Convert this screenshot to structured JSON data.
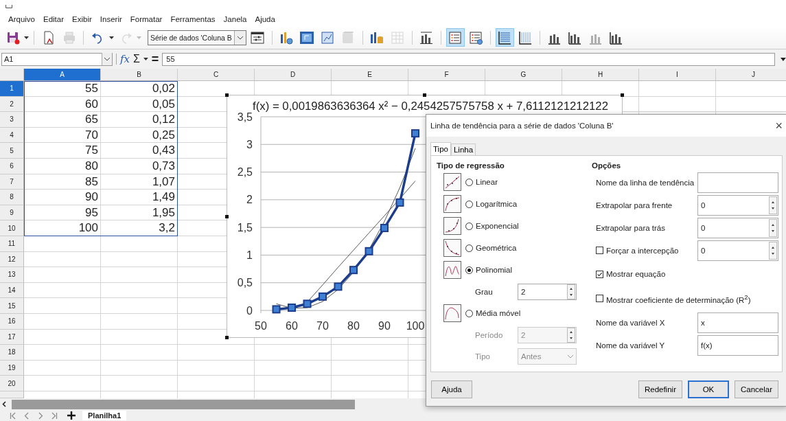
{
  "menu": [
    "Arquivo",
    "Editar",
    "Exibir",
    "Inserir",
    "Formatar",
    "Ferramentas",
    "Janela",
    "Ajuda"
  ],
  "toolbar": [
    {
      "kind": "save",
      "on": false,
      "disabled": false
    },
    {
      "kind": "caret",
      "disabled": false
    },
    {
      "kind": "sep"
    },
    {
      "kind": "export-pdf",
      "on": false,
      "disabled": false
    },
    {
      "kind": "print",
      "on": false,
      "disabled": true
    },
    {
      "kind": "sep"
    },
    {
      "kind": "undo",
      "on": false,
      "disabled": false
    },
    {
      "kind": "caret",
      "disabled": false
    },
    {
      "kind": "redo",
      "on": false,
      "disabled": true
    },
    {
      "kind": "caret",
      "disabled": true
    },
    {
      "kind": "select",
      "value": "Série de dados 'Coluna B"
    },
    {
      "kind": "format-selection",
      "on": false,
      "disabled": false
    },
    {
      "kind": "sep"
    },
    {
      "kind": "chart-type",
      "on": false,
      "disabled": false
    },
    {
      "kind": "chart-wall",
      "on": false,
      "disabled": false
    },
    {
      "kind": "chart-area",
      "on": false,
      "disabled": false
    },
    {
      "kind": "cube",
      "on": false,
      "disabled": true
    },
    {
      "kind": "sep"
    },
    {
      "kind": "data-ranges",
      "on": false,
      "disabled": false
    },
    {
      "kind": "data-table",
      "on": false,
      "disabled": true
    },
    {
      "kind": "sep"
    },
    {
      "kind": "titles",
      "on": false,
      "disabled": false
    },
    {
      "kind": "sep"
    },
    {
      "kind": "legend-toggle",
      "on": true,
      "disabled": false
    },
    {
      "kind": "legend",
      "on": false,
      "disabled": false
    },
    {
      "kind": "sep"
    },
    {
      "kind": "h-grid",
      "on": true,
      "disabled": false
    },
    {
      "kind": "v-grid",
      "on": false,
      "disabled": false
    },
    {
      "kind": "sep"
    },
    {
      "kind": "x-axis",
      "on": false,
      "disabled": false
    },
    {
      "kind": "y-axis",
      "on": false,
      "disabled": false
    },
    {
      "kind": "x-axis",
      "on": false,
      "disabled": true
    },
    {
      "kind": "y-axis",
      "on": false,
      "disabled": false
    }
  ],
  "formula_bar": {
    "name_box": "A1",
    "function_sign": "fx",
    "sum_sign": "Σ",
    "equals_sign": "=",
    "value": "55"
  },
  "sheet": {
    "columns": [
      {
        "label": "A",
        "selected": true
      },
      {
        "label": "B",
        "selected": false
      },
      {
        "label": "C",
        "selected": false
      },
      {
        "label": "D",
        "selected": false
      },
      {
        "label": "E",
        "selected": false
      },
      {
        "label": "F",
        "selected": false
      },
      {
        "label": "G",
        "selected": false
      },
      {
        "label": "H",
        "selected": false
      },
      {
        "label": "I",
        "selected": false
      },
      {
        "label": "J",
        "selected": false
      }
    ],
    "rows": [
      {
        "label": "1",
        "selected": true,
        "cells": [
          "55",
          "0,02"
        ]
      },
      {
        "label": "2",
        "selected": false,
        "cells": [
          "60",
          "0,05"
        ]
      },
      {
        "label": "3",
        "selected": false,
        "cells": [
          "65",
          "0,12"
        ]
      },
      {
        "label": "4",
        "selected": false,
        "cells": [
          "70",
          "0,25"
        ]
      },
      {
        "label": "5",
        "selected": false,
        "cells": [
          "75",
          "0,43"
        ]
      },
      {
        "label": "6",
        "selected": false,
        "cells": [
          "80",
          "0,73"
        ]
      },
      {
        "label": "7",
        "selected": false,
        "cells": [
          "85",
          "1,07"
        ]
      },
      {
        "label": "8",
        "selected": false,
        "cells": [
          "90",
          "1,49"
        ]
      },
      {
        "label": "9",
        "selected": false,
        "cells": [
          "95",
          "1,95"
        ]
      },
      {
        "label": "10",
        "selected": false,
        "cells": [
          "100",
          "3,2"
        ]
      },
      {
        "label": "11",
        "selected": false
      },
      {
        "label": "12",
        "selected": false
      },
      {
        "label": "13",
        "selected": false
      },
      {
        "label": "14",
        "selected": false
      },
      {
        "label": "15",
        "selected": false
      },
      {
        "label": "16",
        "selected": false
      },
      {
        "label": "17",
        "selected": false
      },
      {
        "label": "18",
        "selected": false
      },
      {
        "label": "19",
        "selected": false
      },
      {
        "label": "20",
        "selected": false
      }
    ],
    "sheet_tabs": [
      {
        "label": "Planilha1",
        "selected": true
      }
    ]
  },
  "chart": {
    "chart_data": {
      "type": "line",
      "x": [
        55,
        60,
        65,
        70,
        75,
        80,
        85,
        90,
        95,
        100
      ],
      "grid": true,
      "series": [
        {
          "color": "#1c3c8c",
          "marker": "square",
          "values": [
            0.02,
            0.05,
            0.12,
            0.25,
            0.43,
            0.73,
            1.07,
            1.49,
            1.95,
            3.2
          ]
        },
        {
          "color": "#444444",
          "marker": "none",
          "values": [
            null,
            null,
            0.15,
            0.46,
            0.78,
            1.09,
            1.4,
            1.71,
            2.02,
            2.34
          ]
        },
        {
          "color": "#444444",
          "marker": "none",
          "values": [
            0.12,
            0.04,
            0.05,
            0.16,
            0.38,
            0.69,
            1.1,
            1.61,
            2.22,
            2.93
          ]
        }
      ],
      "xlim": [
        50,
        166
      ],
      "ylim": [
        0,
        3.5
      ],
      "xticks": [
        50,
        60,
        70,
        80,
        90,
        100
      ],
      "yticks": [
        0,
        {
          "value": 0.5,
          "label": "0,5"
        },
        1,
        {
          "value": 1.5,
          "label": "1,5"
        },
        2,
        {
          "value": 2.5,
          "label": "2,5"
        },
        3,
        {
          "value": 3.5,
          "label": "3,5"
        }
      ],
      "annotations": [
        {
          "text": "f(x) = 0,0019863636364 x² − 0,2454257575758 x + 7,6112121212122"
        }
      ]
    }
  },
  "dialog": {
    "title": "Linha de tendência para a série de dados 'Coluna B'",
    "close": "×",
    "tabs": [
      {
        "label": "Tipo",
        "selected": true
      },
      {
        "label": "Linha",
        "selected": false
      }
    ],
    "regression": {
      "heading": "Tipo de regressão",
      "types": [
        {
          "kind": "linear",
          "label": "Linear",
          "selected": false
        },
        {
          "kind": "logarithmic",
          "label": "Logarítmica",
          "selected": false
        },
        {
          "kind": "exponential",
          "label": "Exponencial",
          "selected": false
        },
        {
          "kind": "power",
          "label": "Geométrica",
          "selected": false
        },
        {
          "kind": "polynomial",
          "label": "Polinomial",
          "selected": true,
          "params": [
            {
              "kind": "spin",
              "label": "Grau",
              "value": "2",
              "disabled": false
            }
          ]
        },
        {
          "kind": "moving-average",
          "label": "Média móvel",
          "selected": false,
          "params": [
            {
              "kind": "spin",
              "label": "Período",
              "value": "2",
              "disabled": true
            },
            {
              "kind": "dropdown",
              "label": "Tipo",
              "value": "Antes",
              "disabled": true
            }
          ]
        }
      ]
    },
    "options": {
      "heading": "Opções",
      "items": [
        {
          "kind": "text-field",
          "label": "Nome da linha de tendência"
        },
        {
          "kind": "spin",
          "label": "Extrapolar para frente",
          "value": "0"
        },
        {
          "kind": "spin",
          "label": "Extrapolar para trás",
          "value": "0"
        },
        {
          "kind": "checkbox-spin",
          "label": "Forçar a intercepção",
          "checked": false,
          "value": "0"
        },
        {
          "kind": "checkbox",
          "label": "Mostrar equação",
          "checked": true
        },
        {
          "kind": "checkbox",
          "label": "Mostrar coeficiente de determinação (R$^{2}$)",
          "checked": false
        },
        {
          "kind": "text-field",
          "label": "Nome da variável X",
          "value": "x"
        },
        {
          "kind": "text-field",
          "label": "Nome da variável Y",
          "value": "f(x)"
        }
      ]
    },
    "help_button": {
      "label": "Ajuda"
    },
    "buttons": [
      {
        "label": "Redefinir",
        "default": false
      },
      {
        "label": "OK",
        "default": true
      },
      {
        "label": "Cancelar",
        "default": false
      }
    ]
  }
}
